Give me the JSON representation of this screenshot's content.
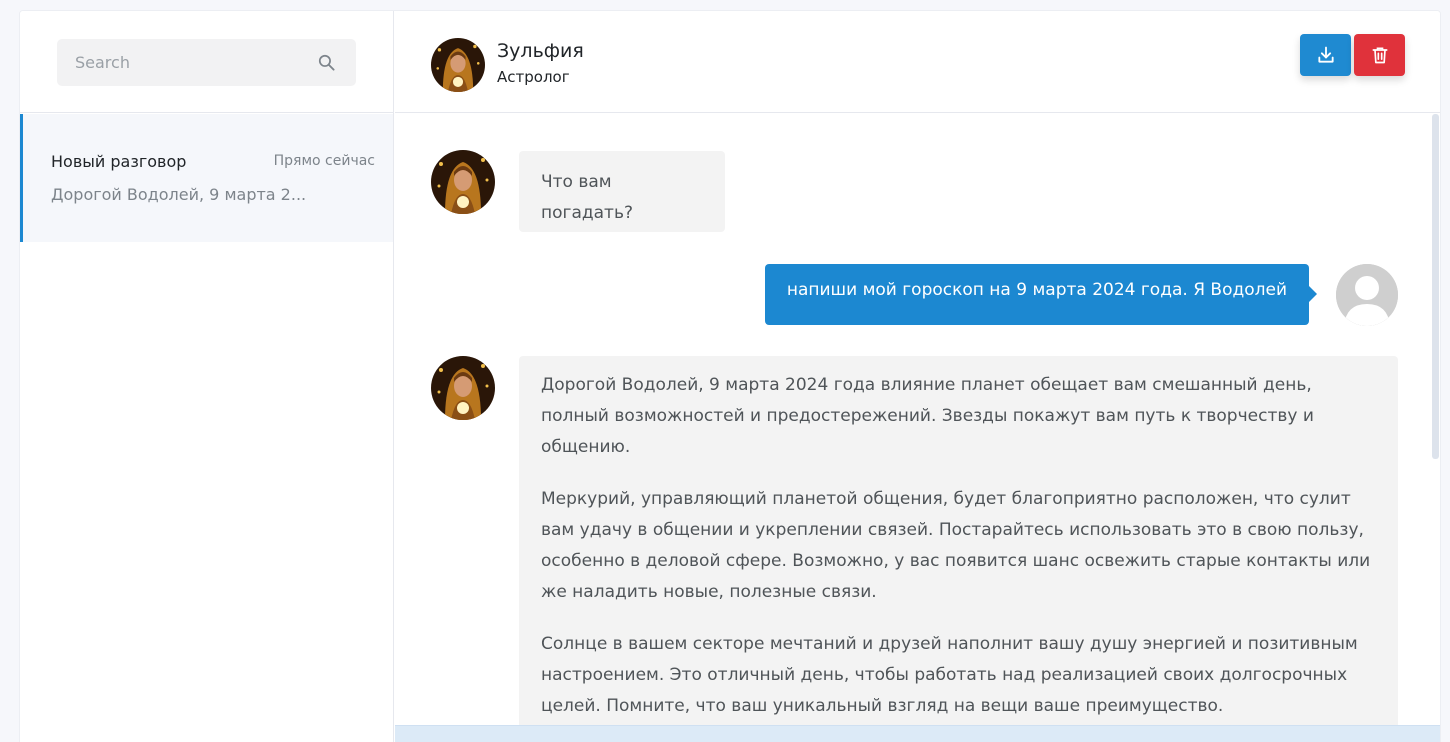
{
  "sidebar": {
    "search_placeholder": "Search",
    "conversations": [
      {
        "title": "Новый разговор",
        "time": "Прямо сейчас",
        "preview": "Дорогой Водолей, 9 марта 2..."
      }
    ]
  },
  "header": {
    "name": "Зульфия",
    "role": "Астролог"
  },
  "messages": [
    {
      "from": "astrologer",
      "paragraphs": [
        "Что вам погадать?"
      ]
    },
    {
      "from": "user",
      "text": "напиши мой гороскоп на 9 марта 2024 года. Я Водолей"
    },
    {
      "from": "astrologer",
      "paragraphs": [
        "Дорогой Водолей, 9 марта 2024 года влияние планет обещает вам смешанный день, полный возможностей и предостережений. Звезды покажут вам путь к творчеству и общению.",
        "Меркурий, управляющий планетой общения, будет благоприятно расположен, что сулит вам удачу в общении и укреплении связей. Постарайтесь использовать это в свою пользу, особенно в деловой сфере. Возможно, у вас появится шанс освежить старые контакты или же наладить новые, полезные связи.",
        "Солнце в вашем секторе мечтаний и друзей наполнит вашу душу энергией и позитивным настроением. Это отличный день, чтобы работать над реализацией своих долгосрочных целей. Помните, что ваш уникальный взгляд на вещи ваше преимущество."
      ]
    }
  ],
  "colors": {
    "accent": "#1c88d1",
    "danger": "#e0323b",
    "bubble_bg": "#f3f3f3",
    "active_conv_bg": "#f5f7fb"
  },
  "icons": {
    "search": "search-icon",
    "download": "download-icon",
    "delete": "trash-icon",
    "user_avatar": "user-placeholder-icon"
  }
}
